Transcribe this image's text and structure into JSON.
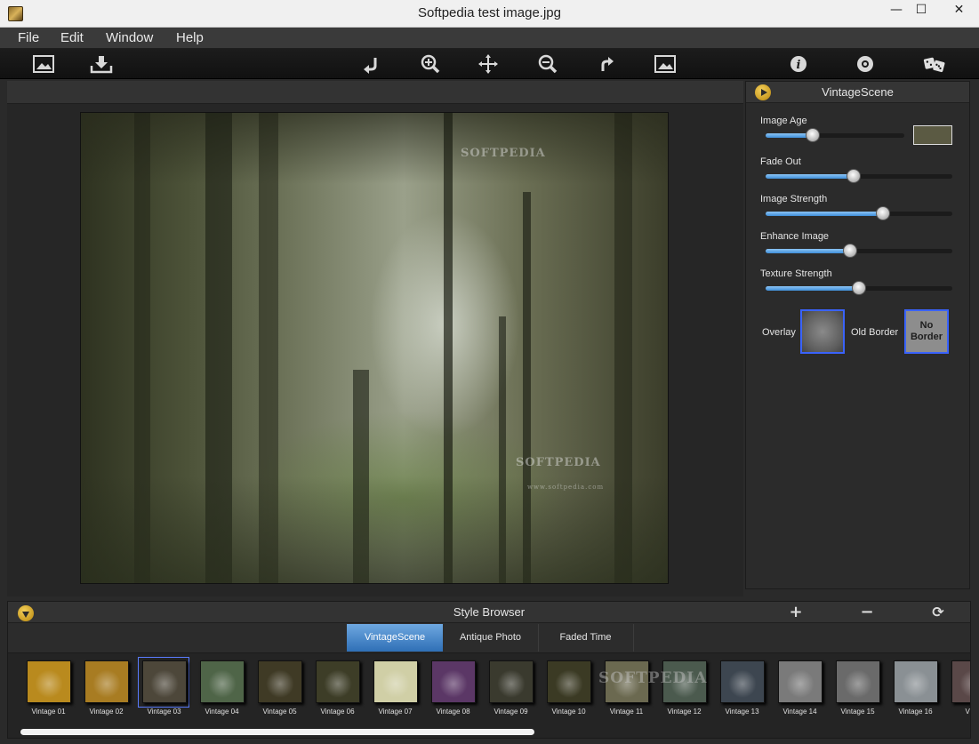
{
  "window": {
    "title": "Softpedia test image.jpg",
    "controls": {
      "minimize": "—",
      "maximize": "☐",
      "close": "✕"
    }
  },
  "menu": [
    "File",
    "Edit",
    "Window",
    "Help"
  ],
  "toolbar": {
    "left": [
      "open-image-icon",
      "save-icon"
    ],
    "center": [
      "rotate-left-icon",
      "zoom-in-icon",
      "pan-icon",
      "zoom-out-icon",
      "rotate-right-icon",
      "fit-image-icon"
    ],
    "right": [
      "info-icon",
      "settings-icon",
      "random-dice-icon"
    ]
  },
  "canvas": {
    "watermarks": [
      "SOFTPEDIA",
      "SOFTPEDIA",
      "www.softpedia.com"
    ]
  },
  "panel": {
    "title": "VintageScene",
    "sliders": [
      {
        "label": "Image Age",
        "value": 0.34
      },
      {
        "label": "Fade Out",
        "value": 0.47
      },
      {
        "label": "Image Strength",
        "value": 0.63
      },
      {
        "label": "Enhance Image",
        "value": 0.45
      },
      {
        "label": "Texture Strength",
        "value": 0.5
      }
    ],
    "image_age_color": "#5b5a43",
    "overlay_label": "Overlay",
    "old_border_label": "Old Border",
    "no_border_label": "No Border"
  },
  "style_browser": {
    "title": "Style Browser",
    "actions": [
      "add-icon",
      "remove-icon",
      "refresh-icon"
    ],
    "tabs": [
      {
        "label": "VintageScene",
        "active": true
      },
      {
        "label": "Antique Photo",
        "active": false
      },
      {
        "label": "Faded Time",
        "active": false
      }
    ],
    "watermark": "SOFTPEDIA",
    "thumbnails": [
      {
        "label": "Vintage 01",
        "color": "#b98a1e",
        "selected": false
      },
      {
        "label": "Vintage 02",
        "color": "#a87c22",
        "selected": false
      },
      {
        "label": "Vintage 03",
        "color": "#4d473a",
        "selected": true
      },
      {
        "label": "Vintage 04",
        "color": "#4f6548",
        "selected": false
      },
      {
        "label": "Vintage 05",
        "color": "#3f3a25",
        "selected": false
      },
      {
        "label": "Vintage 06",
        "color": "#3d3d27",
        "selected": false
      },
      {
        "label": "Vintage 07",
        "color": "#d0cfa6",
        "selected": false
      },
      {
        "label": "Vintage 08",
        "color": "#5b3766",
        "selected": false
      },
      {
        "label": "Vintage 09",
        "color": "#3a3a2e",
        "selected": false
      },
      {
        "label": "Vintage 10",
        "color": "#3b3a24",
        "selected": false
      },
      {
        "label": "Vintage 11",
        "color": "#6b6950",
        "selected": false
      },
      {
        "label": "Vintage 12",
        "color": "#4b5a4e",
        "selected": false
      },
      {
        "label": "Vintage 13",
        "color": "#3d4650",
        "selected": false
      },
      {
        "label": "Vintage 14",
        "color": "#7a7a7a",
        "selected": false
      },
      {
        "label": "Vintage 15",
        "color": "#6a6a6a",
        "selected": false
      },
      {
        "label": "Vintage 16",
        "color": "#8a9094",
        "selected": false
      },
      {
        "label": "Vinta",
        "color": "#5a4848",
        "selected": false
      }
    ]
  }
}
